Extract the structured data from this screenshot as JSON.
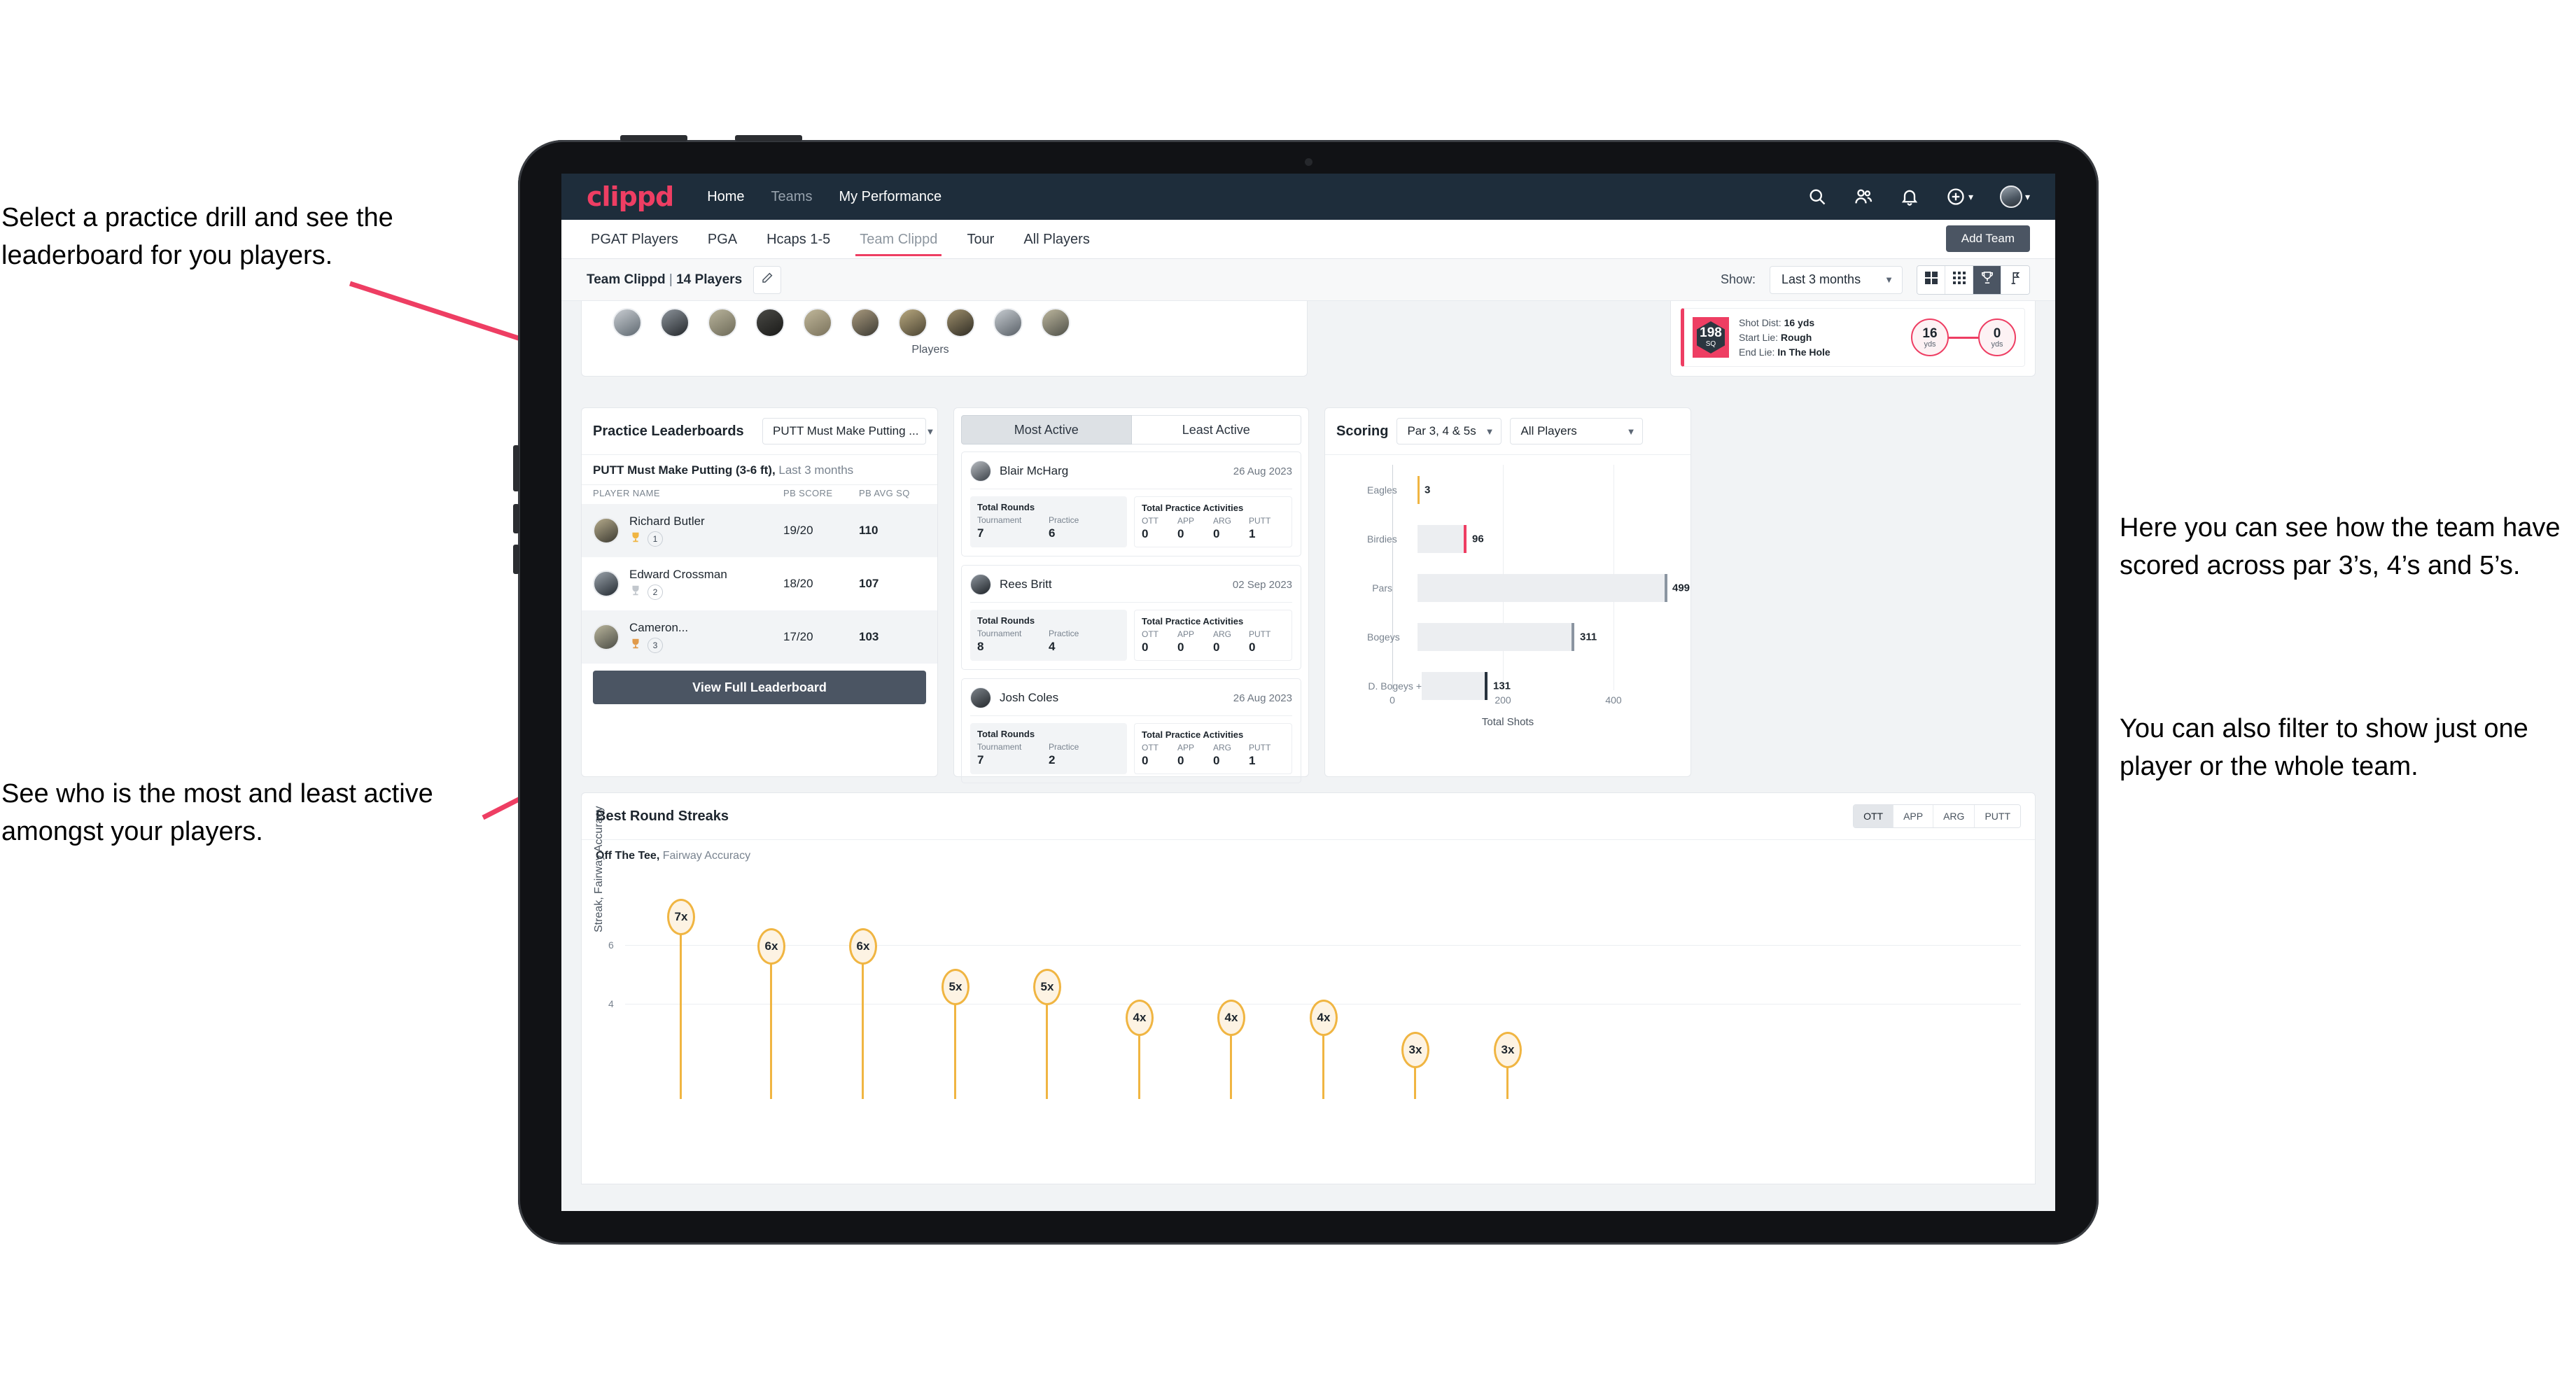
{
  "annotations": {
    "top_left": "Select a practice drill and see the leaderboard for you players.",
    "bottom_left": "See who is the most and least active amongst your players.",
    "right_1": "Here you can see how the team have scored across par 3’s, 4’s and 5’s.",
    "right_2": "You can also filter to show just one player or the whole team.",
    "arrow_color": "#ee3e63"
  },
  "navbar": {
    "logo": "clippd",
    "links": [
      {
        "label": "Home",
        "active": true
      },
      {
        "label": "Teams",
        "active": false
      },
      {
        "label": "My Performance",
        "active": true
      }
    ],
    "icons": [
      "search-icon",
      "people-icon",
      "bell-icon",
      "plus-circle-icon",
      "avatar"
    ]
  },
  "tabs": {
    "items": [
      {
        "label": "PGAT Players",
        "active": false
      },
      {
        "label": "PGA",
        "active": false
      },
      {
        "label": "Hcaps 1-5",
        "active": false
      },
      {
        "label": "Team Clippd",
        "active": true
      },
      {
        "label": "Tour",
        "active": false
      },
      {
        "label": "All Players",
        "active": false
      }
    ],
    "add_team_label": "Add Team"
  },
  "toolbar": {
    "team_name": "Team Clippd",
    "separator": " | ",
    "player_count": "14 Players",
    "edit_icon": "pencil-icon",
    "show_label": "Show:",
    "period_value": "Last 3 months",
    "view_buttons": [
      "grid-large-icon",
      "grid-small-icon",
      "trophy-icon",
      "flag-icon"
    ],
    "active_view": "trophy-icon"
  },
  "players_strip": {
    "caption": "Players",
    "avatar_count": 10
  },
  "shot_card": {
    "badge_value": "198",
    "badge_unit": "SQ",
    "lines": [
      {
        "label": "Shot Dist:",
        "value": "16 yds"
      },
      {
        "label": "Start Lie:",
        "value": "Rough"
      },
      {
        "label": "End Lie:",
        "value": "In The Hole"
      }
    ],
    "start_yards": "16",
    "start_unit": "yds",
    "end_yards": "0",
    "end_unit": "yds"
  },
  "practice_leaderboards": {
    "title": "Practice Leaderboards",
    "drill_select": "PUTT Must Make Putting ...",
    "subtitle_bold": "PUTT Must Make Putting (3-6 ft),",
    "subtitle_light": " Last 3 months",
    "columns": [
      "PLAYER NAME",
      "PB SCORE",
      "PB AVG SQ"
    ],
    "rows": [
      {
        "name": "Richard Butler",
        "rank": "1",
        "pb_score": "19/20",
        "pb_avg_sq": "110",
        "trophy": "gold"
      },
      {
        "name": "Edward Crossman",
        "rank": "2",
        "pb_score": "18/20",
        "pb_avg_sq": "107",
        "trophy": "silver"
      },
      {
        "name": "Cameron...",
        "rank": "3",
        "pb_score": "17/20",
        "pb_avg_sq": "103",
        "trophy": "bronze"
      }
    ],
    "view_full_label": "View Full Leaderboard"
  },
  "activity": {
    "tabs": [
      {
        "label": "Most Active",
        "active": true
      },
      {
        "label": "Least Active",
        "active": false
      }
    ],
    "rounds_title": "Total Rounds",
    "practice_title": "Total Practice Activities",
    "rounds_keys": [
      "Tournament",
      "Practice"
    ],
    "practice_keys": [
      "OTT",
      "APP",
      "ARG",
      "PUTT"
    ],
    "cards": [
      {
        "name": "Blair McHarg",
        "date": "26 Aug 2023",
        "rounds": [
          "7",
          "6"
        ],
        "practice": [
          "0",
          "0",
          "0",
          "1"
        ]
      },
      {
        "name": "Rees Britt",
        "date": "02 Sep 2023",
        "rounds": [
          "8",
          "4"
        ],
        "practice": [
          "0",
          "0",
          "0",
          "0"
        ]
      },
      {
        "name": "Josh Coles",
        "date": "26 Aug 2023",
        "rounds": [
          "7",
          "2"
        ],
        "practice": [
          "0",
          "0",
          "0",
          "1"
        ]
      }
    ]
  },
  "scoring": {
    "title": "Scoring",
    "par_filter": "Par 3, 4 & 5s",
    "player_filter": "All Players"
  },
  "chart_data": [
    {
      "type": "bar",
      "orientation": "horizontal",
      "title": "Scoring",
      "categories": [
        "Eagles",
        "Birdies",
        "Pars",
        "Bogeys",
        "D. Bogeys +"
      ],
      "values": [
        3,
        96,
        499,
        311,
        131
      ],
      "bar_colors": [
        "#f0b542",
        "#ee3e63",
        "#8b95a1",
        "#8b95a1",
        "#27323d"
      ],
      "xlabel": "Total Shots",
      "ylabel": "",
      "xlim": [
        0,
        560
      ],
      "xticks": [
        0,
        200,
        400
      ],
      "grid": true,
      "legend": false
    },
    {
      "type": "scatter",
      "title": "Best Round Streaks",
      "subtitle_bold": "Off The Tee,",
      "subtitle_light": " Fairway Accuracy",
      "ylabel": "Streak, Fairway Accuracy",
      "yticks": [
        4,
        6
      ],
      "ylim": [
        0,
        7.8
      ],
      "values": [
        7,
        6,
        6,
        5,
        5,
        4,
        4,
        4,
        3,
        3
      ],
      "labels": [
        "7x",
        "6x",
        "6x",
        "5x",
        "5x",
        "4x",
        "4x",
        "4x",
        "3x",
        "3x"
      ],
      "marker": "bubble",
      "marker_color": "#f0b542",
      "grid": true,
      "legend": false
    }
  ],
  "streaks_panel": {
    "title": "Best Round Streaks",
    "segments": [
      {
        "label": "OTT",
        "active": true
      },
      {
        "label": "APP",
        "active": false
      },
      {
        "label": "ARG",
        "active": false
      },
      {
        "label": "PUTT",
        "active": false
      }
    ]
  }
}
